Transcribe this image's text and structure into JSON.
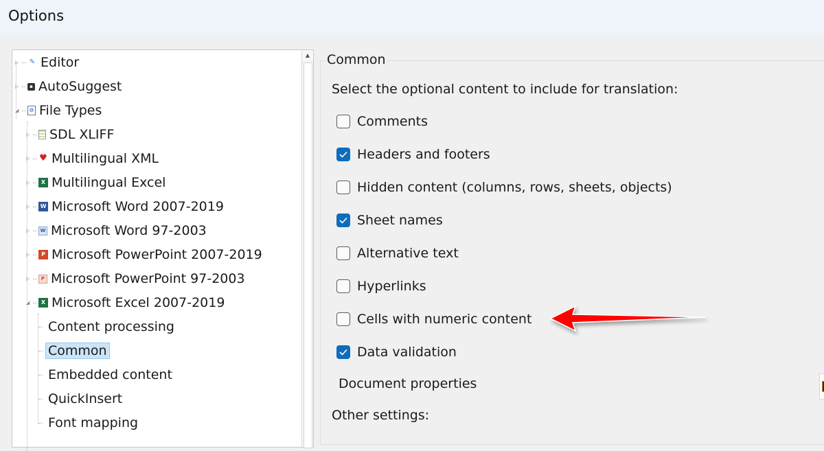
{
  "window": {
    "title": "Options"
  },
  "tree": {
    "items": [
      {
        "label": "Editor",
        "icon": "pencil-icon",
        "expander": "collapsed",
        "level": 0
      },
      {
        "label": "AutoSuggest",
        "icon": "autosuggest-icon",
        "expander": "collapsed",
        "level": 0
      },
      {
        "label": "File Types",
        "icon": "file-types-icon",
        "expander": "expanded",
        "level": 0
      },
      {
        "label": "SDL XLIFF",
        "icon": "sdl-xliff-icon",
        "expander": "collapsed",
        "level": 1
      },
      {
        "label": "Multilingual XML",
        "icon": "multilingual-xml-icon",
        "expander": "collapsed",
        "level": 1
      },
      {
        "label": "Multilingual Excel",
        "icon": "multilingual-excel-icon",
        "expander": "collapsed",
        "level": 1
      },
      {
        "label": "Microsoft Word 2007-2019",
        "icon": "word-icon",
        "expander": "collapsed",
        "level": 1
      },
      {
        "label": "Microsoft Word 97-2003",
        "icon": "word-legacy-icon",
        "expander": "collapsed",
        "level": 1
      },
      {
        "label": "Microsoft PowerPoint 2007-2019",
        "icon": "powerpoint-icon",
        "expander": "collapsed",
        "level": 1
      },
      {
        "label": "Microsoft PowerPoint 97-2003",
        "icon": "powerpoint-legacy-icon",
        "expander": "collapsed",
        "level": 1
      },
      {
        "label": "Microsoft Excel 2007-2019",
        "icon": "excel-icon",
        "expander": "expanded",
        "level": 1
      },
      {
        "label": "Content processing",
        "level": 2
      },
      {
        "label": "Common",
        "level": 2,
        "selected": true
      },
      {
        "label": "Embedded content",
        "level": 2
      },
      {
        "label": "QuickInsert",
        "level": 2
      },
      {
        "label": "Font mapping",
        "level": 2
      }
    ]
  },
  "panel": {
    "group_title": "Common",
    "intro": "Select the optional content to include for translation:",
    "options": [
      {
        "label": "Comments",
        "checked": false
      },
      {
        "label": "Headers and footers",
        "checked": true
      },
      {
        "label": "Hidden content (columns, rows, sheets, objects)",
        "checked": false
      },
      {
        "label": "Sheet names",
        "checked": true
      },
      {
        "label": "Alternative text",
        "checked": false
      },
      {
        "label": "Hyperlinks",
        "checked": false
      },
      {
        "label": "Cells with numeric content",
        "checked": false
      },
      {
        "label": "Data validation",
        "checked": true
      }
    ],
    "document_properties": "Document properties",
    "other_settings": "Other settings:"
  },
  "annotation": {
    "type": "red-arrow",
    "points_to": "Cells with numeric content",
    "color": "#ff0000"
  },
  "colors": {
    "accent": "#0f6cbd",
    "selection": "#cce4f7"
  }
}
